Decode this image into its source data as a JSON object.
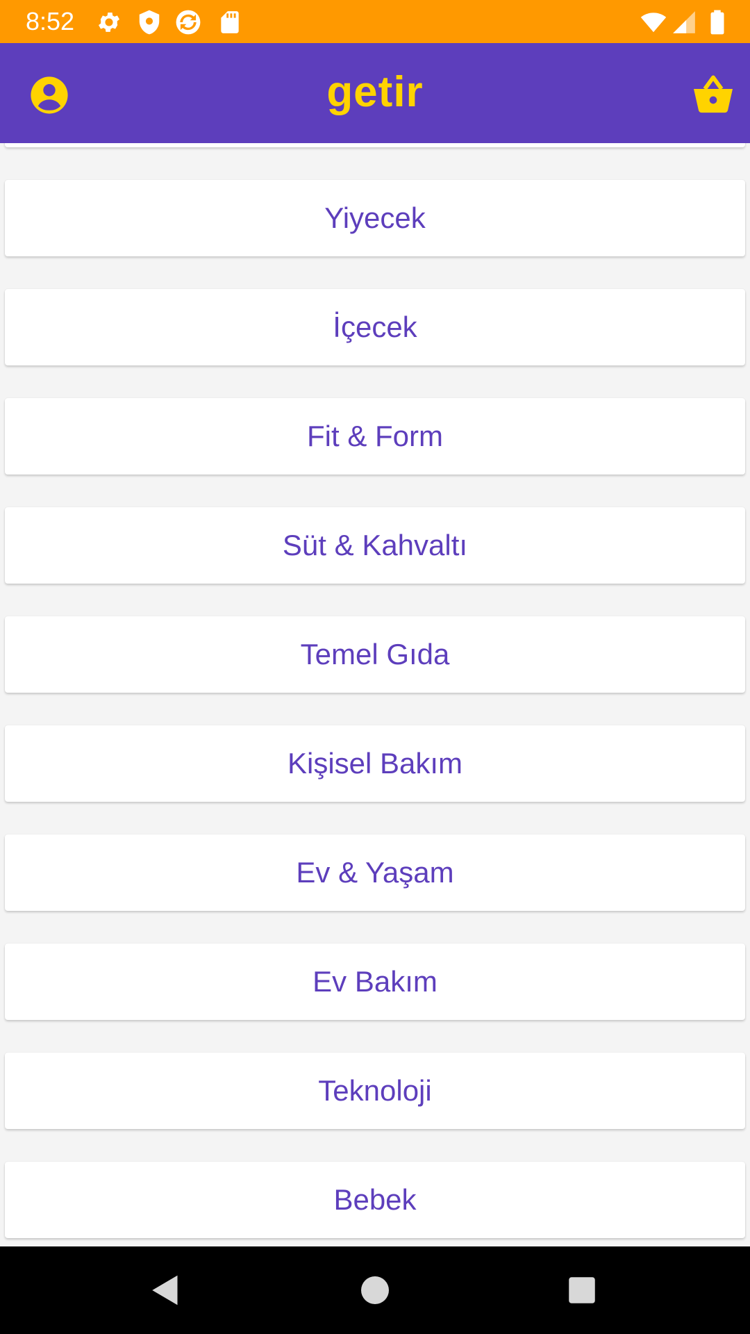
{
  "status_bar": {
    "time": "8:52",
    "background": "#ff9900",
    "left_icons": [
      "settings-icon",
      "shield-icon",
      "sync-icon",
      "sd-card-icon"
    ],
    "right_icons": [
      "wifi-icon",
      "signal-icon",
      "battery-icon"
    ]
  },
  "app_bar": {
    "logo_text": "getir",
    "background": "#5d3ebc",
    "accent": "#ffd300",
    "left_icon": "profile-icon",
    "right_icon": "basket-icon"
  },
  "categories": [
    {
      "label": "Yiyecek"
    },
    {
      "label": "İçecek"
    },
    {
      "label": "Fit & Form"
    },
    {
      "label": "Süt & Kahvaltı"
    },
    {
      "label": "Temel Gıda"
    },
    {
      "label": "Kişisel Bakım"
    },
    {
      "label": "Ev & Yaşam"
    },
    {
      "label": "Ev Bakım"
    },
    {
      "label": "Teknoloji"
    },
    {
      "label": "Bebek"
    }
  ],
  "nav_bar": {
    "buttons": [
      "back-icon",
      "home-icon",
      "recents-icon"
    ]
  }
}
